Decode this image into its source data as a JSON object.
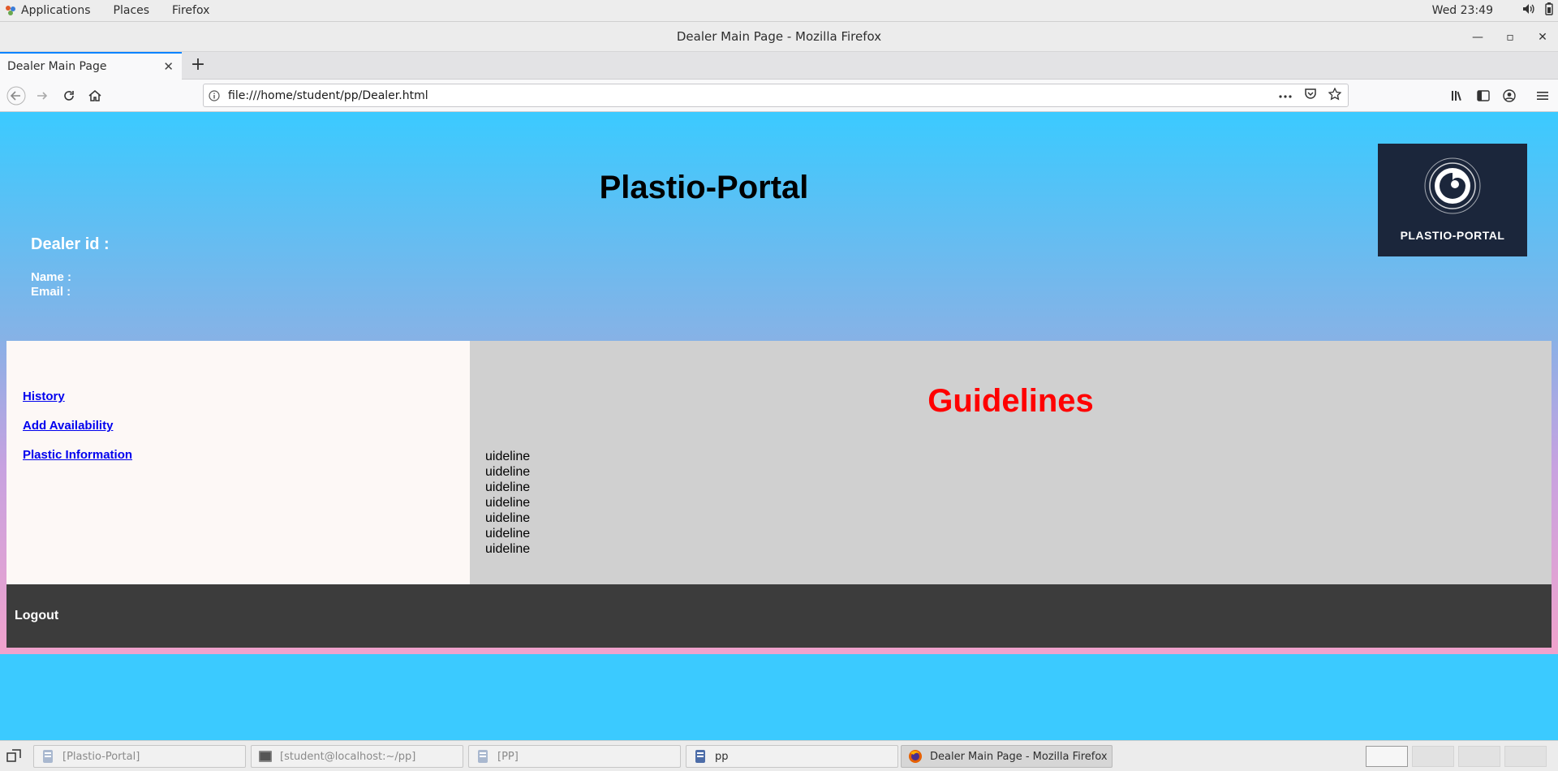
{
  "topbar": {
    "applications": "Applications",
    "places": "Places",
    "firefox": "Firefox",
    "clock": "Wed 23:49",
    "tray_icons": [
      "volume-icon",
      "battery-icon"
    ]
  },
  "window": {
    "title": "Dealer Main Page - Mozilla Firefox",
    "controls": [
      "minimize-icon",
      "maximize-icon",
      "close-icon"
    ]
  },
  "browser": {
    "tab_label": "Dealer Main Page",
    "url": "file:///home/student/pp/Dealer.html"
  },
  "page": {
    "site_title": "Plastio-Portal",
    "dealer_id_label": "Dealer id :",
    "name_label": "Name :",
    "email_label": "Email :",
    "logo_text": "PLASTIO-PORTAL",
    "nav_links": [
      "History",
      "Add Availability",
      "Plastic Information"
    ],
    "guidelines_title": "Guidelines",
    "guidelines": [
      "uideline",
      "uideline",
      "uideline",
      "uideline",
      "uideline",
      "uideline",
      "uideline"
    ],
    "logout_label": "Logout",
    "colors": {
      "page_bg": "#3bcaff",
      "guidelines_title": "#ff0000",
      "links": "#0000ee",
      "footer": "#3c3c3c",
      "logo_bg": "#1b263b"
    }
  },
  "taskbar": {
    "items": [
      {
        "label": "[Plastio-Portal]",
        "icon": "file-manager-icon"
      },
      {
        "label": "[student@localhost:~/pp]",
        "icon": "terminal-icon"
      },
      {
        "label": "[PP]",
        "icon": "file-manager-icon"
      },
      {
        "label": "pp",
        "icon": "file-manager-icon"
      },
      {
        "label": "Dealer Main Page - Mozilla Firefox",
        "icon": "firefox-icon"
      }
    ],
    "workspaces": 4
  }
}
